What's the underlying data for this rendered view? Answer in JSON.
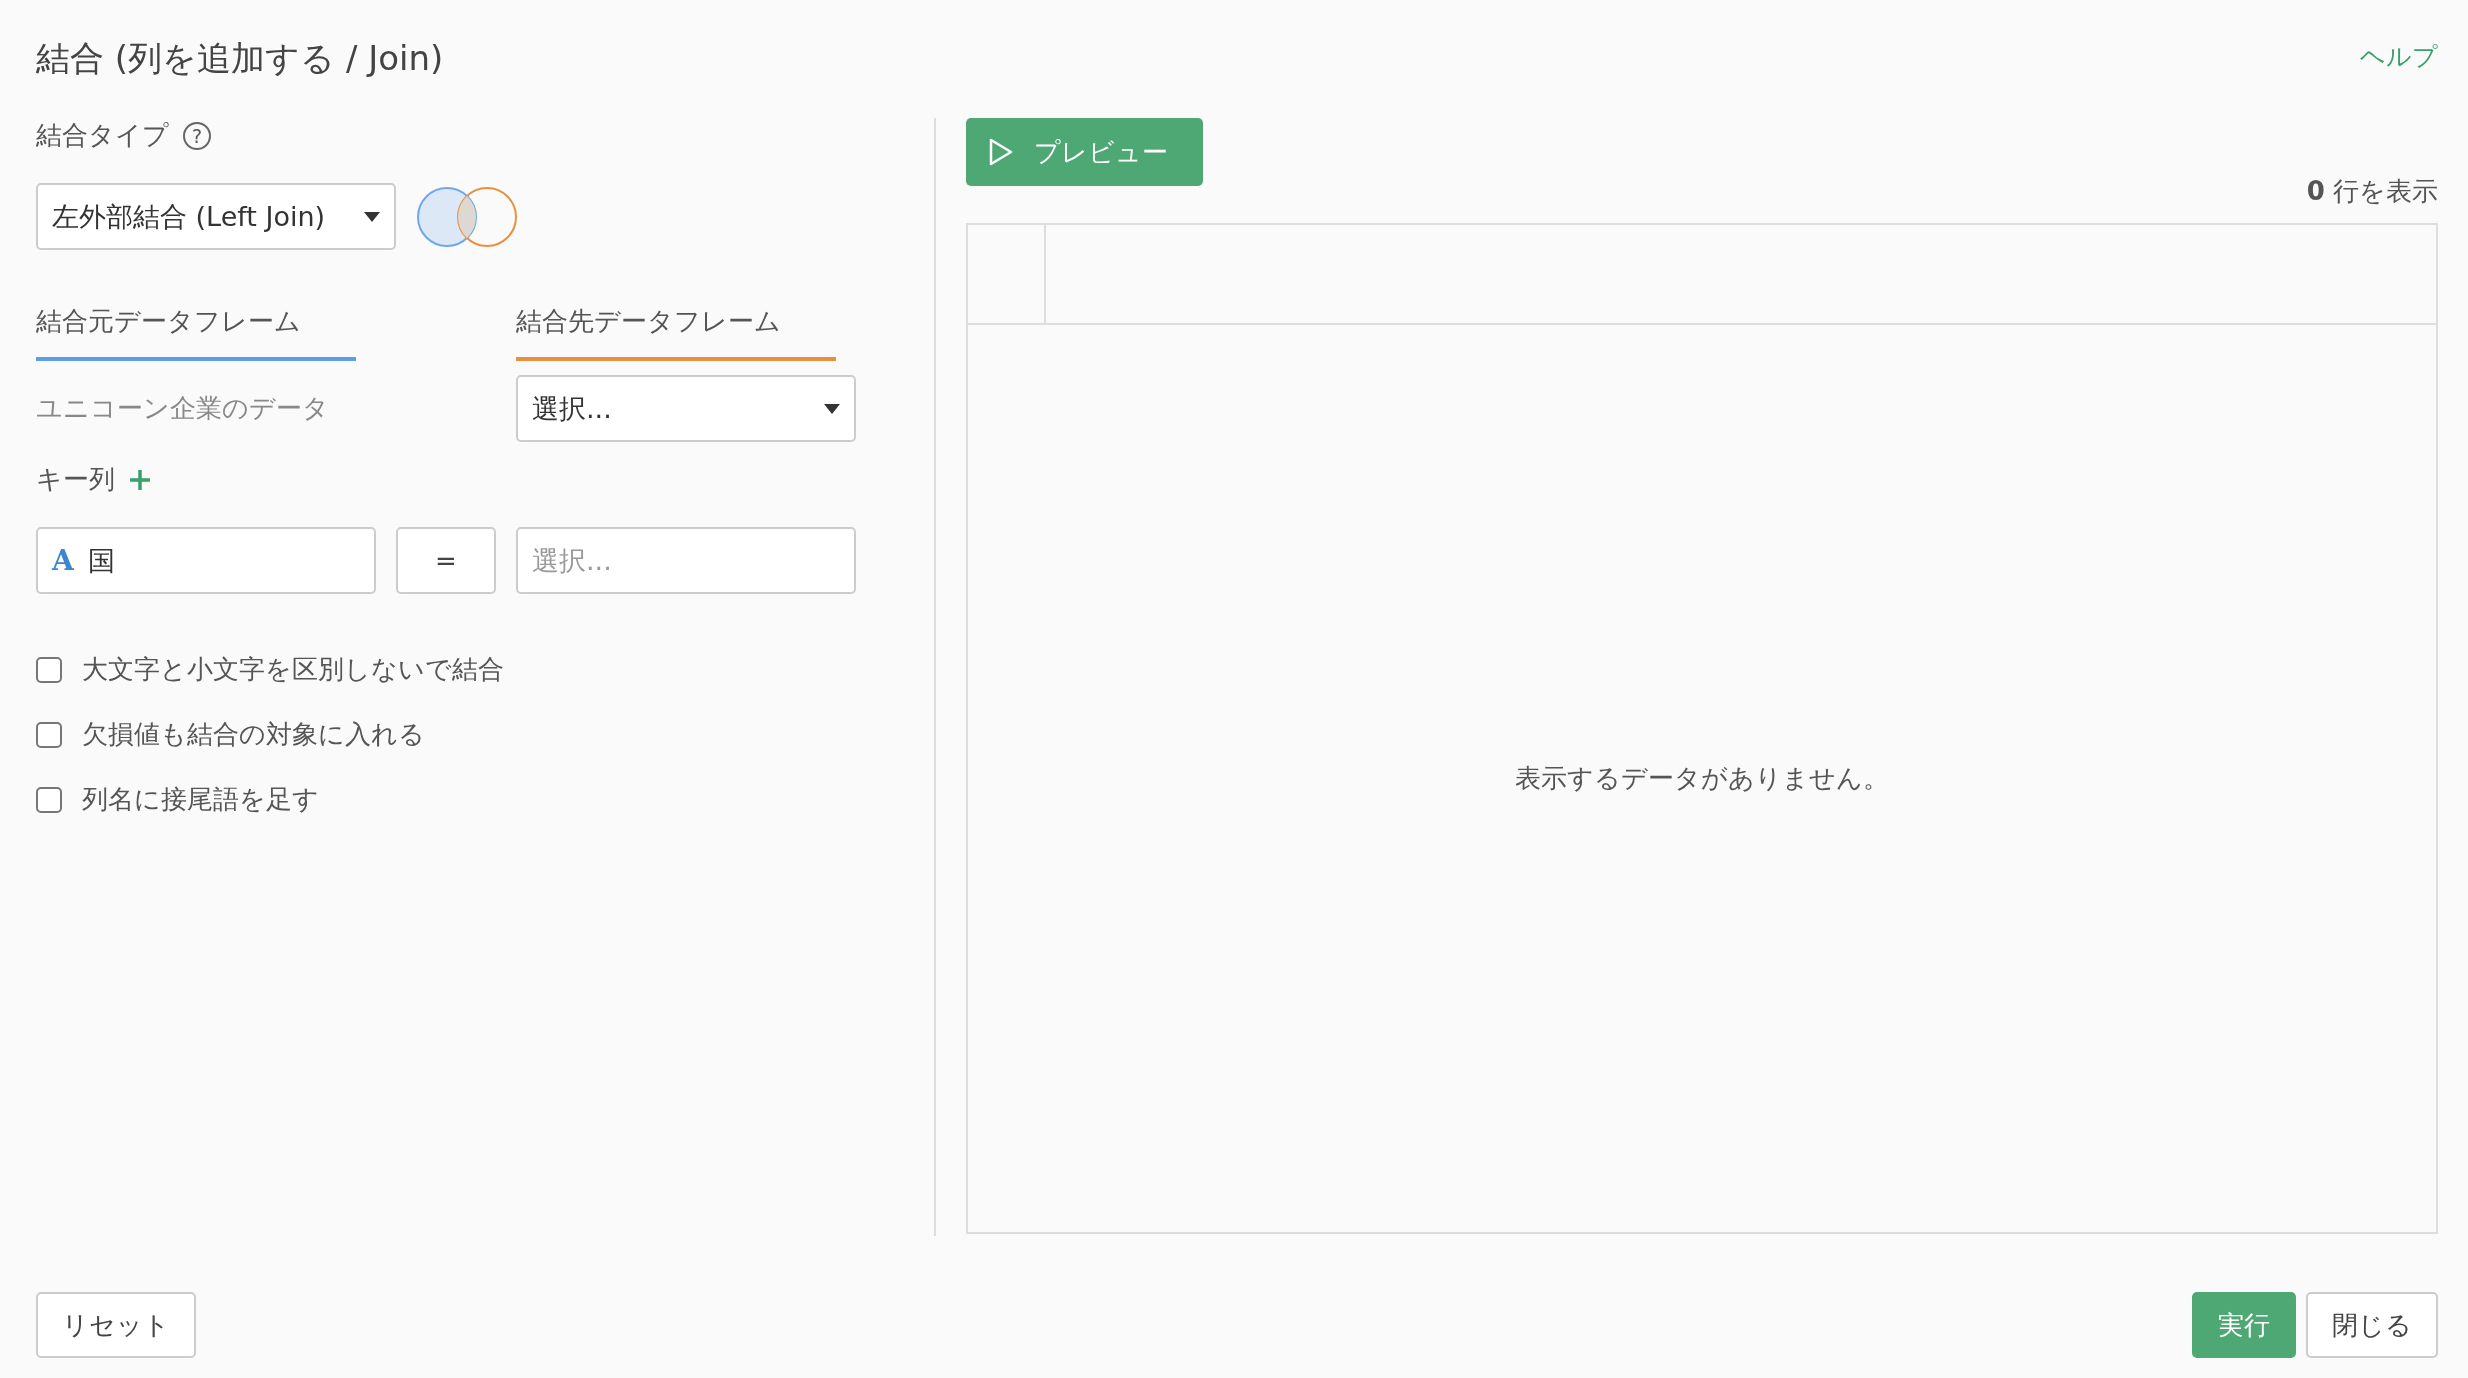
{
  "title": "結合 (列を追加する / Join)",
  "help_link": "ヘルプ",
  "join_type": {
    "label": "結合タイプ",
    "help_icon": "?",
    "value": "左外部結合 (Left Join)"
  },
  "dataframes": [
    {
      "label": "結合元データフレーム",
      "color": "#5b9fe8"
    },
    {
      "label": "結合先データフレーム",
      "color": "#e8903f"
    }
  ],
  "source_dataframe": "ユニコーン企業のデータ",
  "target_dataframe": {
    "placeholder": "選択..."
  },
  "key_columns": {
    "label": "キー列",
    "rows": [
      {
        "left": {
          "type_icon": "A",
          "value": "国"
        },
        "operator": "=",
        "right": {
          "placeholder": "選択..."
        }
      }
    ]
  },
  "options": [
    {
      "label": "大文字と小文字を区別しないで結合",
      "checked": false
    },
    {
      "label": "欠損値も結合の対象に入れる",
      "checked": false
    },
    {
      "label": "列名に接尾語を足す",
      "checked": false
    }
  ],
  "preview": {
    "button": "プレビュー",
    "row_count": "0",
    "row_count_suffix": "行を表示",
    "empty_message": "表示するデータがありません。"
  },
  "footer": {
    "reset": "リセット",
    "run": "実行",
    "close": "閉じる"
  }
}
